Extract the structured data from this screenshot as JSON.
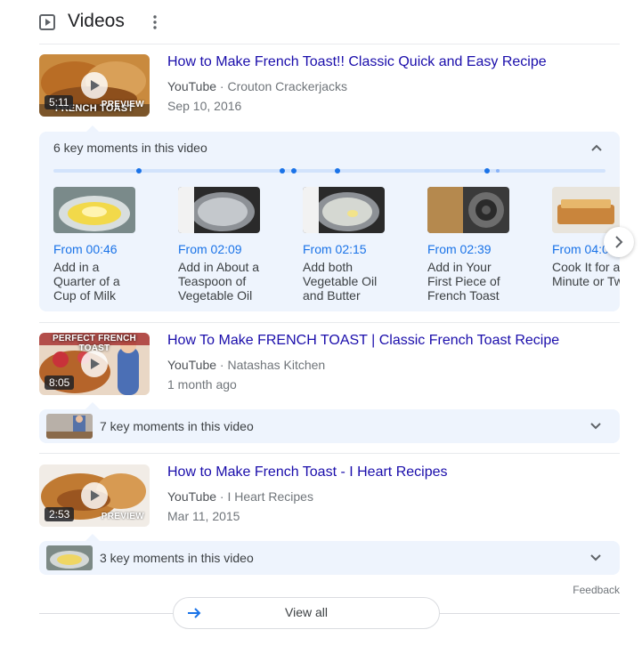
{
  "header": {
    "title": "Videos",
    "icon": "play-box-icon",
    "menu_icon": "more-vert-icon"
  },
  "videos": [
    {
      "title": "How to Make French Toast!! Classic Quick and Easy Recipe",
      "source": "YouTube",
      "channel": "· Crouton Crackerjacks",
      "date": "Sep 10, 2016",
      "duration": "5:11",
      "thumb_text": "FRENCH TOAST",
      "preview": "PREVIEW"
    },
    {
      "title": "How To Make FRENCH TOAST | Classic French Toast Recipe",
      "source": "YouTube",
      "channel": "· Natashas Kitchen",
      "date": "1 month ago",
      "duration": "8:05",
      "thumb_text": "PERFECT FRENCH TOAST",
      "preview": ""
    },
    {
      "title": "How to Make French Toast - I Heart Recipes",
      "source": "YouTube",
      "channel": "· I Heart Recipes",
      "date": "Mar 11, 2015",
      "duration": "2:53",
      "thumb_text": "",
      "preview": "PREVIEW"
    }
  ],
  "key_moments": {
    "heading": "6 key moments in this video",
    "moments": [
      {
        "time": "From 00:46",
        "desc": "Add in a Quarter of a Cup of Milk"
      },
      {
        "time": "From 02:09",
        "desc": "Add in About a Teaspoon of Vegetable Oil"
      },
      {
        "time": "From 02:15",
        "desc": "Add both Vegetable Oil and Butter"
      },
      {
        "time": "From 02:39",
        "desc": "Add in Your First Piece of French Toast"
      },
      {
        "time": "From 04:0",
        "desc": "Cook It for a Minute or Tw"
      }
    ]
  },
  "collapsed_moments": [
    {
      "label": "7 key moments in this video"
    },
    {
      "label": "3 key moments in this video"
    }
  ],
  "footer": {
    "feedback": "Feedback",
    "view_all": "View all"
  },
  "colors": {
    "title_link": "#1a0dab",
    "accent": "#1a73e8",
    "panel_bg": "#eef4fd"
  }
}
